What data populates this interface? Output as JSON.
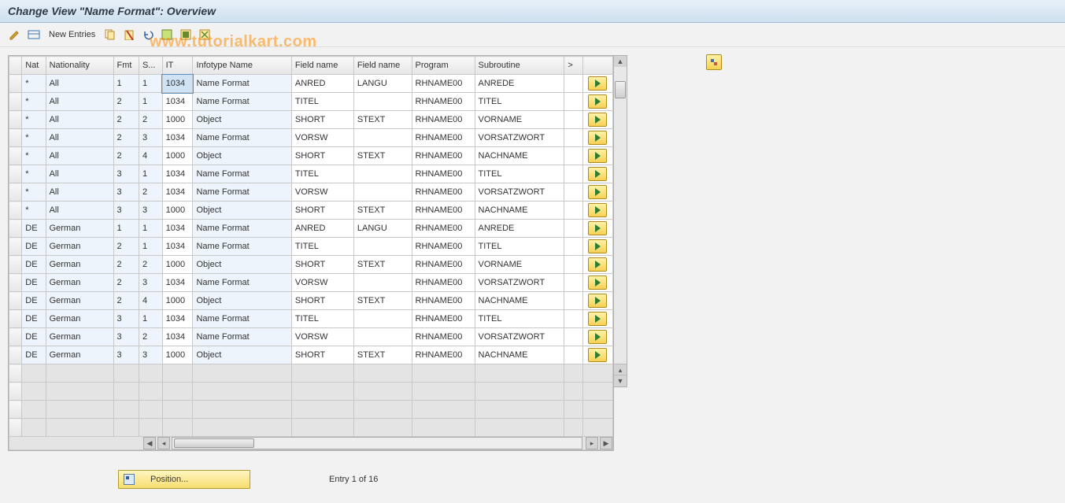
{
  "title": "Change View \"Name Format\": Overview",
  "watermark": "www.tutorialkart.com",
  "toolbar": {
    "new_entries": "New Entries"
  },
  "columns": {
    "nat": "Nat",
    "nationality": "Nationality",
    "fmt": "Fmt",
    "s": "S...",
    "it": "IT",
    "infotype_name": "Infotype Name",
    "field_name1": "Field name",
    "field_name2": "Field name",
    "program": "Program",
    "subroutine": "Subroutine",
    "more": ">"
  },
  "rows": [
    {
      "nat": "*",
      "nationality": "All",
      "fmt": "1",
      "s": "1",
      "it": "1034",
      "itn": "Name Format",
      "f1": "ANRED",
      "f2": "LANGU",
      "prog": "RHNAME00",
      "sub": "ANREDE"
    },
    {
      "nat": "*",
      "nationality": "All",
      "fmt": "2",
      "s": "1",
      "it": "1034",
      "itn": "Name Format",
      "f1": "TITEL",
      "f2": "",
      "prog": "RHNAME00",
      "sub": "TITEL"
    },
    {
      "nat": "*",
      "nationality": "All",
      "fmt": "2",
      "s": "2",
      "it": "1000",
      "itn": "Object",
      "f1": "SHORT",
      "f2": "STEXT",
      "prog": "RHNAME00",
      "sub": "VORNAME"
    },
    {
      "nat": "*",
      "nationality": "All",
      "fmt": "2",
      "s": "3",
      "it": "1034",
      "itn": "Name Format",
      "f1": "VORSW",
      "f2": "",
      "prog": "RHNAME00",
      "sub": "VORSATZWORT"
    },
    {
      "nat": "*",
      "nationality": "All",
      "fmt": "2",
      "s": "4",
      "it": "1000",
      "itn": "Object",
      "f1": "SHORT",
      "f2": "STEXT",
      "prog": "RHNAME00",
      "sub": "NACHNAME"
    },
    {
      "nat": "*",
      "nationality": "All",
      "fmt": "3",
      "s": "1",
      "it": "1034",
      "itn": "Name Format",
      "f1": "TITEL",
      "f2": "",
      "prog": "RHNAME00",
      "sub": "TITEL"
    },
    {
      "nat": "*",
      "nationality": "All",
      "fmt": "3",
      "s": "2",
      "it": "1034",
      "itn": "Name Format",
      "f1": "VORSW",
      "f2": "",
      "prog": "RHNAME00",
      "sub": "VORSATZWORT"
    },
    {
      "nat": "*",
      "nationality": "All",
      "fmt": "3",
      "s": "3",
      "it": "1000",
      "itn": "Object",
      "f1": "SHORT",
      "f2": "STEXT",
      "prog": "RHNAME00",
      "sub": "NACHNAME"
    },
    {
      "nat": "DE",
      "nationality": "German",
      "fmt": "1",
      "s": "1",
      "it": "1034",
      "itn": "Name Format",
      "f1": "ANRED",
      "f2": "LANGU",
      "prog": "RHNAME00",
      "sub": "ANREDE"
    },
    {
      "nat": "DE",
      "nationality": "German",
      "fmt": "2",
      "s": "1",
      "it": "1034",
      "itn": "Name Format",
      "f1": "TITEL",
      "f2": "",
      "prog": "RHNAME00",
      "sub": "TITEL"
    },
    {
      "nat": "DE",
      "nationality": "German",
      "fmt": "2",
      "s": "2",
      "it": "1000",
      "itn": "Object",
      "f1": "SHORT",
      "f2": "STEXT",
      "prog": "RHNAME00",
      "sub": "VORNAME"
    },
    {
      "nat": "DE",
      "nationality": "German",
      "fmt": "2",
      "s": "3",
      "it": "1034",
      "itn": "Name Format",
      "f1": "VORSW",
      "f2": "",
      "prog": "RHNAME00",
      "sub": "VORSATZWORT"
    },
    {
      "nat": "DE",
      "nationality": "German",
      "fmt": "2",
      "s": "4",
      "it": "1000",
      "itn": "Object",
      "f1": "SHORT",
      "f2": "STEXT",
      "prog": "RHNAME00",
      "sub": "NACHNAME"
    },
    {
      "nat": "DE",
      "nationality": "German",
      "fmt": "3",
      "s": "1",
      "it": "1034",
      "itn": "Name Format",
      "f1": "TITEL",
      "f2": "",
      "prog": "RHNAME00",
      "sub": "TITEL"
    },
    {
      "nat": "DE",
      "nationality": "German",
      "fmt": "3",
      "s": "2",
      "it": "1034",
      "itn": "Name Format",
      "f1": "VORSW",
      "f2": "",
      "prog": "RHNAME00",
      "sub": "VORSATZWORT"
    },
    {
      "nat": "DE",
      "nationality": "German",
      "fmt": "3",
      "s": "3",
      "it": "1000",
      "itn": "Object",
      "f1": "SHORT",
      "f2": "STEXT",
      "prog": "RHNAME00",
      "sub": "NACHNAME"
    }
  ],
  "empty_row_count": 4,
  "footer": {
    "position_label": "Position...",
    "entry_text": "Entry 1 of 16"
  }
}
